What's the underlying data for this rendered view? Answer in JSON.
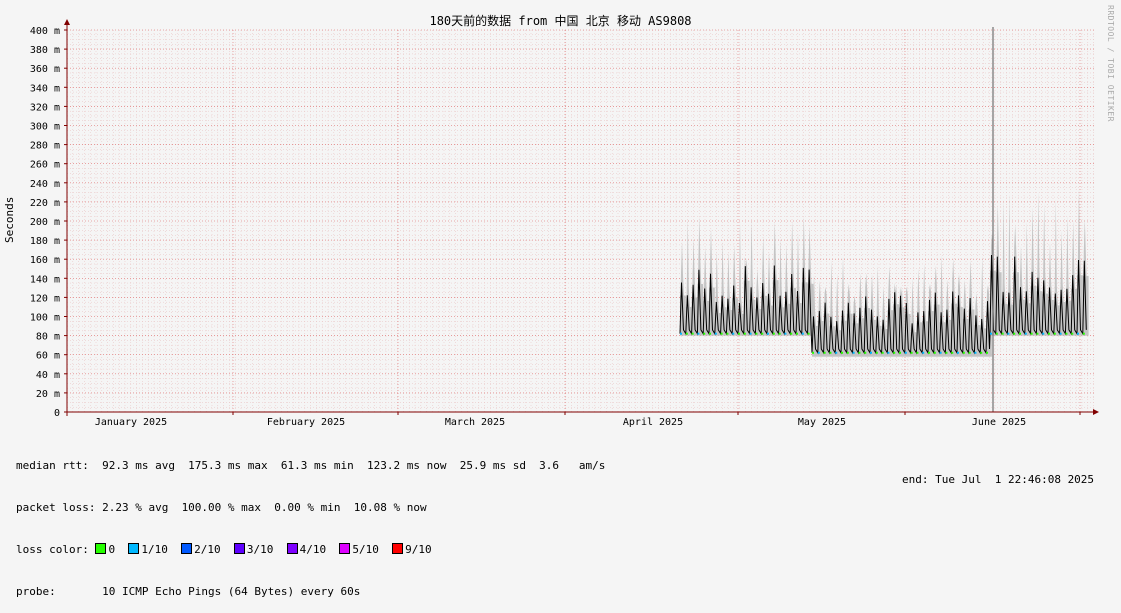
{
  "chart_data": {
    "type": "area",
    "title": "180天前的数据 from 中国 北京 移动 AS9808",
    "ylabel": "Seconds",
    "watermark": "RRDTOOL / TOBI OETIKER",
    "ylim": [
      0,
      400
    ],
    "y_ticks": [
      "0",
      "20 m",
      "40 m",
      "60 m",
      "80 m",
      "100 m",
      "120 m",
      "140 m",
      "160 m",
      "180 m",
      "200 m",
      "220 m",
      "240 m",
      "260 m",
      "280 m",
      "300 m",
      "320 m",
      "340 m",
      "360 m",
      "380 m",
      "400 m"
    ],
    "x_ticks": [
      "January 2025",
      "February 2025",
      "March 2025",
      "April 2025",
      "May 2025",
      "June 2025"
    ],
    "grid": true,
    "colors": {
      "background": "#f5f5f5",
      "grid_minor": "#e8c0c0",
      "grid_major": "#e07070",
      "smoke": "#c4c4c4",
      "median": "#000000",
      "axis": "#800000"
    },
    "series": [
      {
        "segment": "April 2025 – late May 2025",
        "median_rtt_ms": {
          "base": 82,
          "daily_peak": 140
        },
        "smoke_ms": {
          "low": 80,
          "high": 210
        }
      },
      {
        "segment": "May 2025 – end of May 2025",
        "median_rtt_ms": {
          "base": 62,
          "daily_peak": 115
        },
        "smoke_ms": {
          "low": 58,
          "high": 165
        }
      },
      {
        "segment": "June 2025 – July 1 2025",
        "median_rtt_ms": {
          "base": 82,
          "daily_peak": 155
        },
        "smoke_ms": {
          "low": 80,
          "high": 235
        }
      }
    ]
  },
  "stats": {
    "median_rtt": "median rtt:  92.3 ms avg  175.3 ms max  61.3 ms min  123.2 ms now  25.9 ms sd  3.6   am/s",
    "packet_loss": "packet loss: 2.23 % avg  100.00 % max  0.00 % min  10.08 % now",
    "loss_color_label": "loss color: ",
    "loss_colors": [
      {
        "label": "0",
        "color": "#26ff00"
      },
      {
        "label": "1/10",
        "color": "#00b8ff"
      },
      {
        "label": "2/10",
        "color": "#0059ff"
      },
      {
        "label": "3/10",
        "color": "#5e00ff"
      },
      {
        "label": "4/10",
        "color": "#7e00ff"
      },
      {
        "label": "5/10",
        "color": "#dd00ff"
      },
      {
        "label": "9/10",
        "color": "#ff0000"
      }
    ],
    "probe": "probe:       10 ICMP Echo Pings (64 Bytes) every 60s",
    "end": "end: Tue Jul  1 22:46:08 2025"
  }
}
